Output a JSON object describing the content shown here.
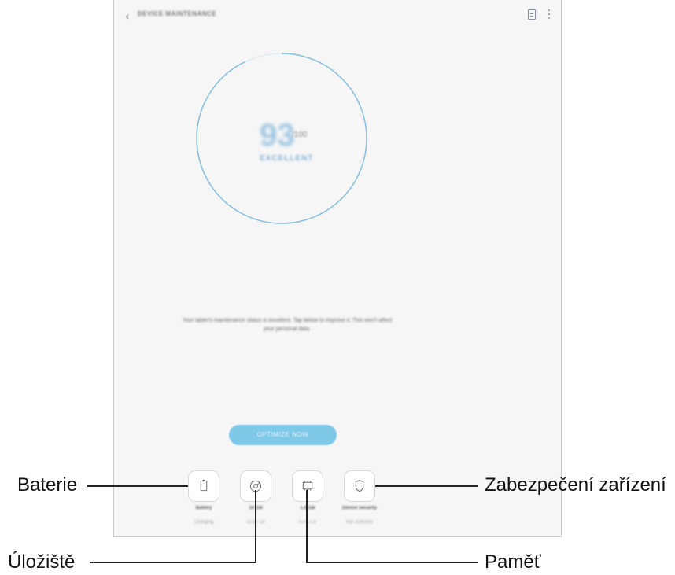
{
  "appbar": {
    "title": "DEVICE MAINTENANCE"
  },
  "gauge": {
    "score": "93",
    "out_of": "/100",
    "status": "EXCELLENT",
    "level_fraction": 0.93,
    "accent": "#86bfe0"
  },
  "description": "Your tablet's maintenance status is excellent. Tap below to improve it. This won't affect your personal data.",
  "optimize_button": "OPTIMIZE NOW",
  "tiles": [
    {
      "name": "Battery",
      "sub": "Charging",
      "icon": "battery-icon"
    },
    {
      "name": "16 GB",
      "sub": "10.8 / 16",
      "icon": "storage-icon"
    },
    {
      "name": "1.8 GB",
      "sub": "0.8 / 1.8",
      "icon": "memory-chip-icon"
    },
    {
      "name": "Device security",
      "sub": "Not scanned",
      "icon": "shield-icon"
    }
  ],
  "callouts": {
    "battery": "Baterie",
    "storage": "Úložiště",
    "memory": "Paměť",
    "security": "Zabezpečení zařízení"
  },
  "colors": {
    "button": "#7ec8e8",
    "line": "#222222"
  }
}
